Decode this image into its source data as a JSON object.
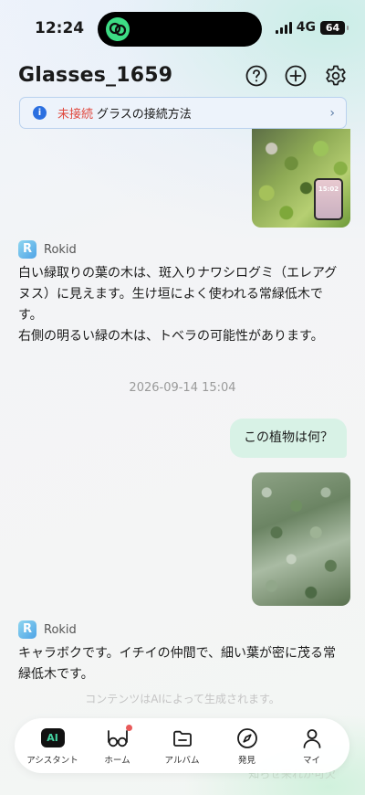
{
  "status_bar": {
    "time": "12:24",
    "network": "4G",
    "battery": "64"
  },
  "header": {
    "title": "Glasses_1659"
  },
  "banner": {
    "status": "未接続",
    "text": "グラスの接続方法",
    "accent_color": "#e0493f"
  },
  "chat": {
    "messages": [
      {
        "sender": "Rokid",
        "lines": [
          "白い緑取りの葉の木は、斑入りナワシログミ（エレアグ",
          "ヌス）に見えます。生け垣によく使われる常緑低木で",
          "す。",
          "右側の明るい緑の木は、トベラの可能性があります。"
        ]
      },
      {
        "timestamp": "2026-09-14 15:04"
      },
      {
        "user_text": "この植物は何？"
      },
      {
        "sender": "Rokid",
        "lines": [
          "キャラボクです。イチイの仲間で、細い葉が密に茂る常",
          "緑低木です。"
        ]
      }
    ],
    "phone_clock": "15:02",
    "disclaimer": "コンテンツはAIによって生成されます。",
    "ghost_text": "知らせ来れが可欠"
  },
  "tabs": [
    {
      "label": "アシスタント",
      "icon": "ai-assistant-icon",
      "badge": "AI"
    },
    {
      "label": "ホーム",
      "icon": "glasses-icon"
    },
    {
      "label": "アルバム",
      "icon": "folder-icon"
    },
    {
      "label": "発見",
      "icon": "compass-icon"
    },
    {
      "label": "マイ",
      "icon": "person-icon"
    }
  ]
}
